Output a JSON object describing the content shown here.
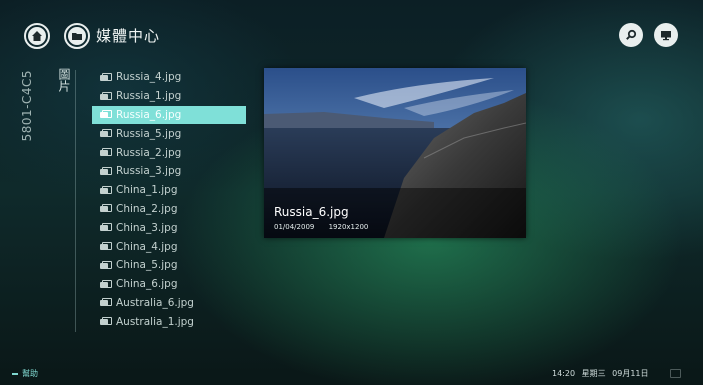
{
  "header": {
    "title": "媒體中心",
    "home_icon": "home-icon",
    "folder_icon": "folder-icon",
    "search_icon": "search-icon",
    "screen_icon": "monitor-icon"
  },
  "sidebar": {
    "device_id": "5801-C4C5",
    "category": "圖片"
  },
  "files": [
    {
      "name": "Russia_4.jpg"
    },
    {
      "name": "Russia_1.jpg"
    },
    {
      "name": "Russia_6.jpg",
      "selected": true
    },
    {
      "name": "Russia_5.jpg"
    },
    {
      "name": "Russia_2.jpg"
    },
    {
      "name": "Russia_3.jpg"
    },
    {
      "name": "China_1.jpg"
    },
    {
      "name": "China_2.jpg"
    },
    {
      "name": "China_3.jpg"
    },
    {
      "name": "China_4.jpg"
    },
    {
      "name": "China_5.jpg"
    },
    {
      "name": "China_6.jpg"
    },
    {
      "name": "Australia_6.jpg"
    },
    {
      "name": "Australia_1.jpg"
    }
  ],
  "preview": {
    "name": "Russia_6.jpg",
    "date": "01/04/2009",
    "resolution": "1920x1200"
  },
  "footer": {
    "help_label": "幫助",
    "time": "14:20",
    "weekday": "星期三",
    "date": "09月11日"
  },
  "colors": {
    "accent": "#7fe0d8",
    "text": "#c3d1cf"
  }
}
